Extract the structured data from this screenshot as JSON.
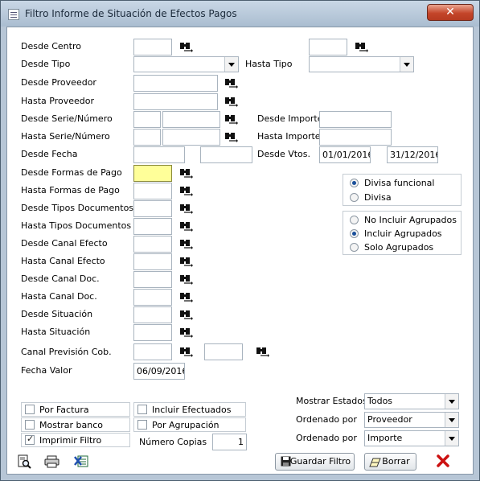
{
  "window": {
    "title": "Filtro Informe de Situación de Efectos Pagos",
    "close": "✕"
  },
  "rows": {
    "desde_centro": "Desde Centro",
    "desde_tipo": "Desde Tipo",
    "hasta_tipo": "Hasta Tipo",
    "desde_proveedor": "Desde Proveedor",
    "hasta_proveedor": "Hasta Proveedor",
    "desde_serie": "Desde Serie/Número",
    "hasta_serie": "Hasta Serie/Número",
    "desde_importe": "Desde Importe",
    "hasta_importe": "Hasta Importe",
    "desde_fecha": "Desde Fecha",
    "desde_vtos": "Desde Vtos.",
    "desde_formas": "Desde Formas de Pago",
    "hasta_formas": "Hasta Formas de Pago",
    "desde_tipos_doc": "Desde Tipos Documentos",
    "hasta_tipos_doc": "Hasta Tipos Documentos",
    "desde_canal_efecto": "Desde Canal Efecto",
    "hasta_canal_efecto": "Hasta Canal Efecto",
    "desde_canal_doc": "Desde Canal Doc.",
    "hasta_canal_doc": "Hasta Canal Doc.",
    "desde_situacion": "Desde Situación",
    "hasta_situacion": "Hasta Situación",
    "canal_prevision": "Canal Previsión Cob.",
    "fecha_valor": "Fecha Valor"
  },
  "values": {
    "vtos_desde": "01/01/2016",
    "vtos_hasta": "31/12/2016",
    "fecha_valor": "06/09/2016",
    "numero_copias": "1"
  },
  "divisa": {
    "funcional": "Divisa funcional",
    "divisa": "Divisa",
    "selected": "funcional"
  },
  "agrupados": {
    "no_incluir": "No Incluir Agrupados",
    "incluir": "Incluir Agrupados",
    "solo": "Solo Agrupados",
    "selected": "incluir"
  },
  "checks": {
    "por_factura": "Por Factura",
    "mostrar_banco": "Mostrar banco",
    "imprimir_filtro": "Imprimir Filtro",
    "incluir_efectuados": "Incluir Efectuados",
    "por_agrupacion": "Por Agrupación",
    "numero_copias": "Número Copias"
  },
  "options": {
    "mostrar_estados_label": "Mostrar Estados",
    "mostrar_estados_value": "Todos",
    "ordenado_por_1_label": "Ordenado por",
    "ordenado_por_1_value": "Proveedor",
    "ordenado_por_2_label": "Ordenado por",
    "ordenado_por_2_value": "Importe"
  },
  "buttons": {
    "guardar": "Guardar Filtro",
    "borrar": "Borrar"
  },
  "colors": {
    "highlight": "#ffff99",
    "close": "#c4452a",
    "cancel_x": "#cc1111"
  }
}
